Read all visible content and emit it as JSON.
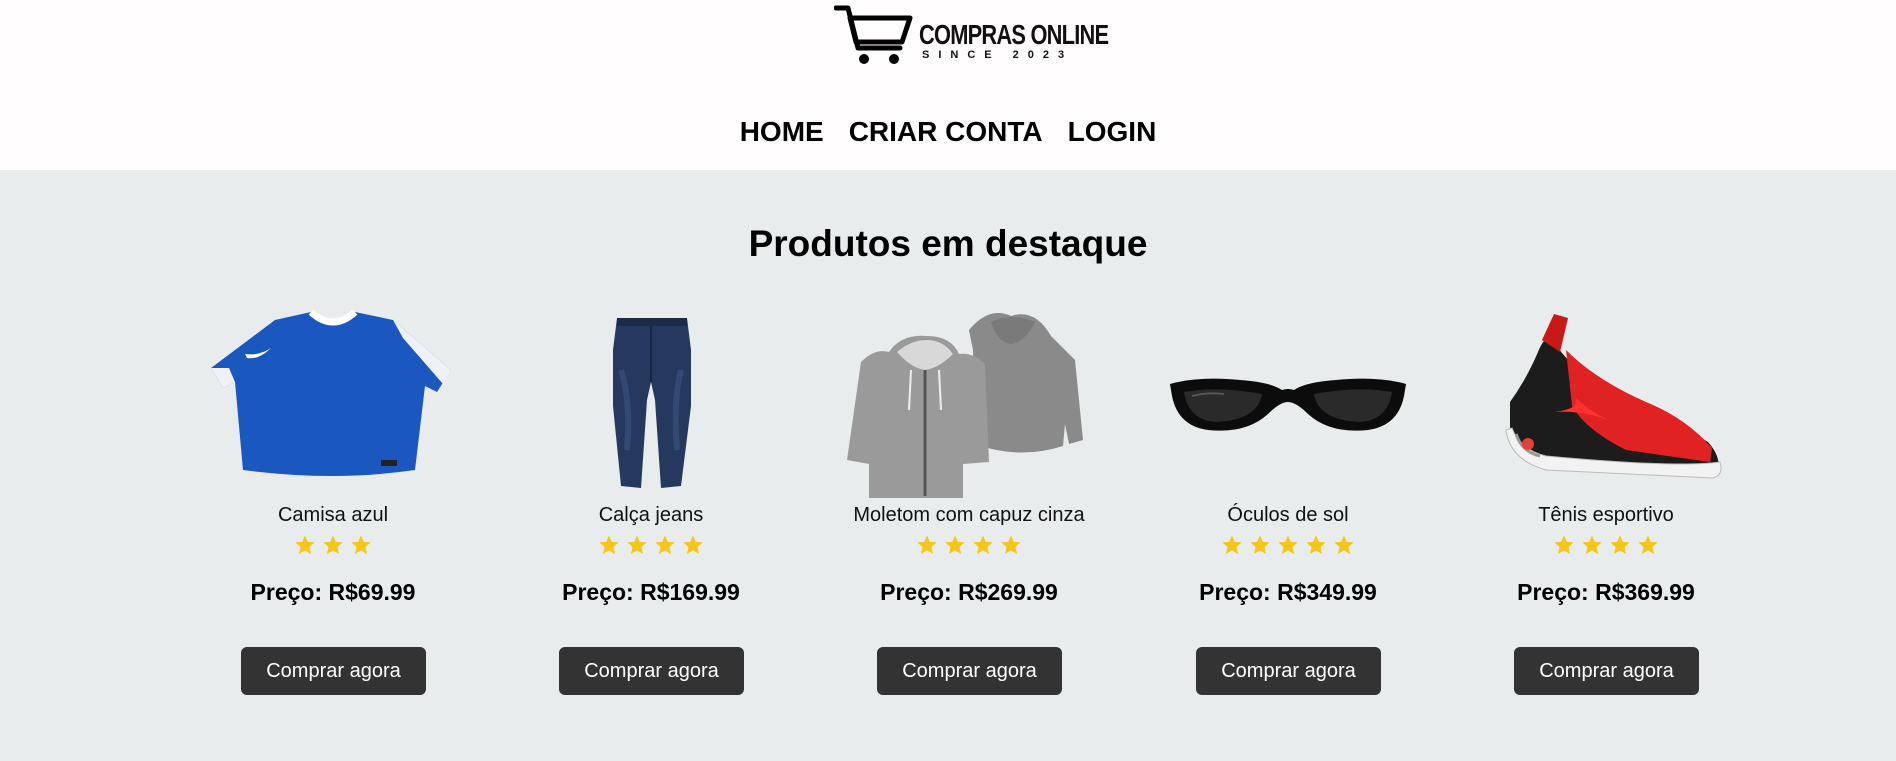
{
  "brand": {
    "name": "COMPRAS ONLINE",
    "since": "SINCE 2023",
    "logo_icon": "shopping-cart-icon"
  },
  "nav": {
    "items": [
      "HOME",
      "CRIAR CONTA",
      "LOGIN"
    ]
  },
  "section": {
    "title": "Produtos em destaque"
  },
  "colors": {
    "star": "#f5c518",
    "button_bg": "#333333",
    "page_bg": "#e8ecec"
  },
  "products": [
    {
      "name": "Camisa azul",
      "rating": 3,
      "price_label": "Preço: R$69.99",
      "button": "Comprar agora",
      "image_icon": "blue-shirt-icon"
    },
    {
      "name": "Calça jeans",
      "rating": 4,
      "price_label": "Preço: R$169.99",
      "button": "Comprar agora",
      "image_icon": "jeans-icon"
    },
    {
      "name": "Moletom com capuz cinza",
      "rating": 4,
      "price_label": "Preço: R$269.99",
      "button": "Comprar agora",
      "image_icon": "hoodie-icon"
    },
    {
      "name": "Óculos de sol",
      "rating": 5,
      "price_label": "Preço: R$349.99",
      "button": "Comprar agora",
      "image_icon": "sunglasses-icon"
    },
    {
      "name": "Tênis esportivo",
      "rating": 4,
      "price_label": "Preço: R$369.99",
      "button": "Comprar agora",
      "image_icon": "sneaker-icon"
    }
  ]
}
